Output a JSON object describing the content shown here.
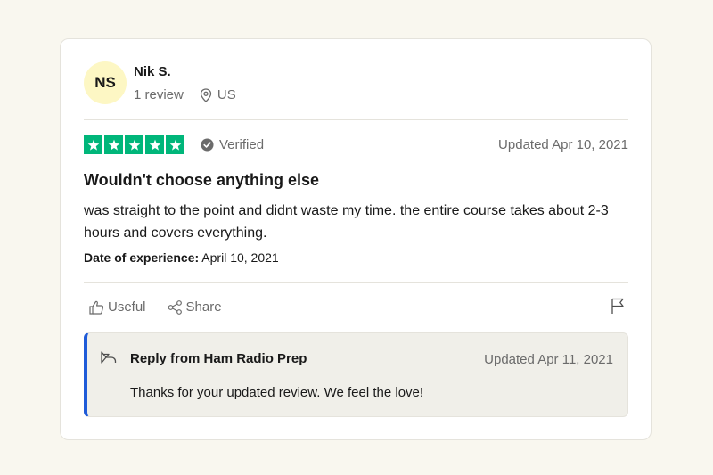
{
  "reviewer": {
    "initials": "NS",
    "name": "Nik S.",
    "review_count": "1 review",
    "location": "US"
  },
  "rating": {
    "stars": 5,
    "max_stars": 5,
    "star_color": "#00b67a",
    "verified_label": "Verified",
    "updated": "Updated Apr 10, 2021"
  },
  "review": {
    "title": "Wouldn't choose anything else",
    "body": "was straight to the point and didnt waste my time. the entire course takes about 2-3 hours and covers everything.",
    "experience_label": "Date of experience:",
    "experience_date": "April 10, 2021"
  },
  "actions": {
    "useful_label": "Useful",
    "share_label": "Share"
  },
  "reply": {
    "from": "Reply from Ham Radio Prep",
    "updated": "Updated Apr 11, 2021",
    "text": "Thanks for your updated review. We feel the love!",
    "accent_color": "#1f5bd8"
  },
  "colors": {
    "background": "#f9f7ef",
    "avatar_bg": "#fdf7c4",
    "reply_bg": "#f0efe9"
  }
}
